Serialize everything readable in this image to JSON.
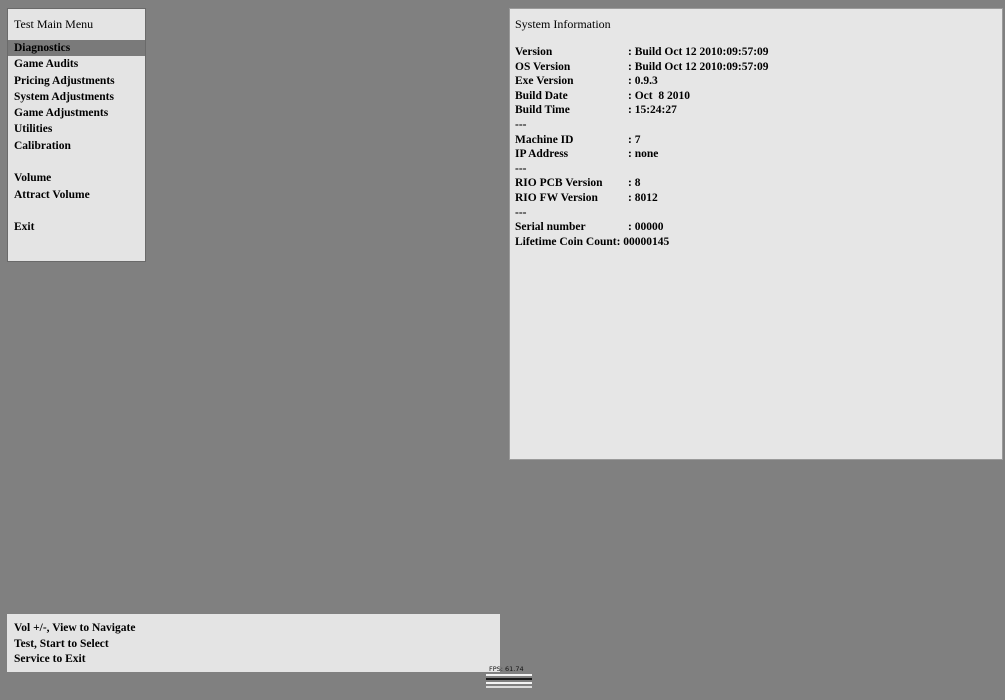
{
  "menu": {
    "title": "Test Main Menu",
    "items": [
      {
        "label": "Diagnostics",
        "selected": true
      },
      {
        "label": "Game Audits",
        "selected": false
      },
      {
        "label": "Pricing Adjustments",
        "selected": false
      },
      {
        "label": "System Adjustments",
        "selected": false
      },
      {
        "label": "Game Adjustments",
        "selected": false
      },
      {
        "label": "Utilities",
        "selected": false
      },
      {
        "label": "Calibration",
        "selected": false
      },
      {
        "label": "",
        "selected": false
      },
      {
        "label": "Volume",
        "selected": false
      },
      {
        "label": "Attract Volume",
        "selected": false
      },
      {
        "label": "",
        "selected": false
      },
      {
        "label": "Exit",
        "selected": false
      }
    ]
  },
  "system_info": {
    "title": "System Information",
    "rows": [
      {
        "label": "Version",
        "value": ": Build Oct 12 2010:09:57:09"
      },
      {
        "label": "OS Version",
        "value": ": Build Oct 12 2010:09:57:09"
      },
      {
        "label": "Exe Version",
        "value": ": 0.9.3"
      },
      {
        "label": "Build Date",
        "value": ": Oct  8 2010"
      },
      {
        "label": "Build Time",
        "value": ": 15:24:27"
      },
      {
        "label": "---",
        "value": ""
      },
      {
        "label": "Machine ID",
        "value": ": 7"
      },
      {
        "label": "IP Address",
        "value": ": none"
      },
      {
        "label": "---",
        "value": ""
      },
      {
        "label": "RIO PCB Version",
        "value": ": 8"
      },
      {
        "label": "RIO FW Version",
        "value": ": 8012"
      },
      {
        "label": "---",
        "value": ""
      },
      {
        "label": "Serial number",
        "value": ": 00000"
      },
      {
        "label": "Lifetime Coin Count:",
        "value": "00000145"
      }
    ]
  },
  "help": {
    "lines": [
      "Vol +/-, View to Navigate",
      "Test, Start to Select",
      "Service to Exit"
    ]
  },
  "fps": {
    "label": "FPS: 61.74"
  },
  "colors": {
    "background": "#808080",
    "panel": "#e4e4e4",
    "selection": "#7a7a7a"
  }
}
